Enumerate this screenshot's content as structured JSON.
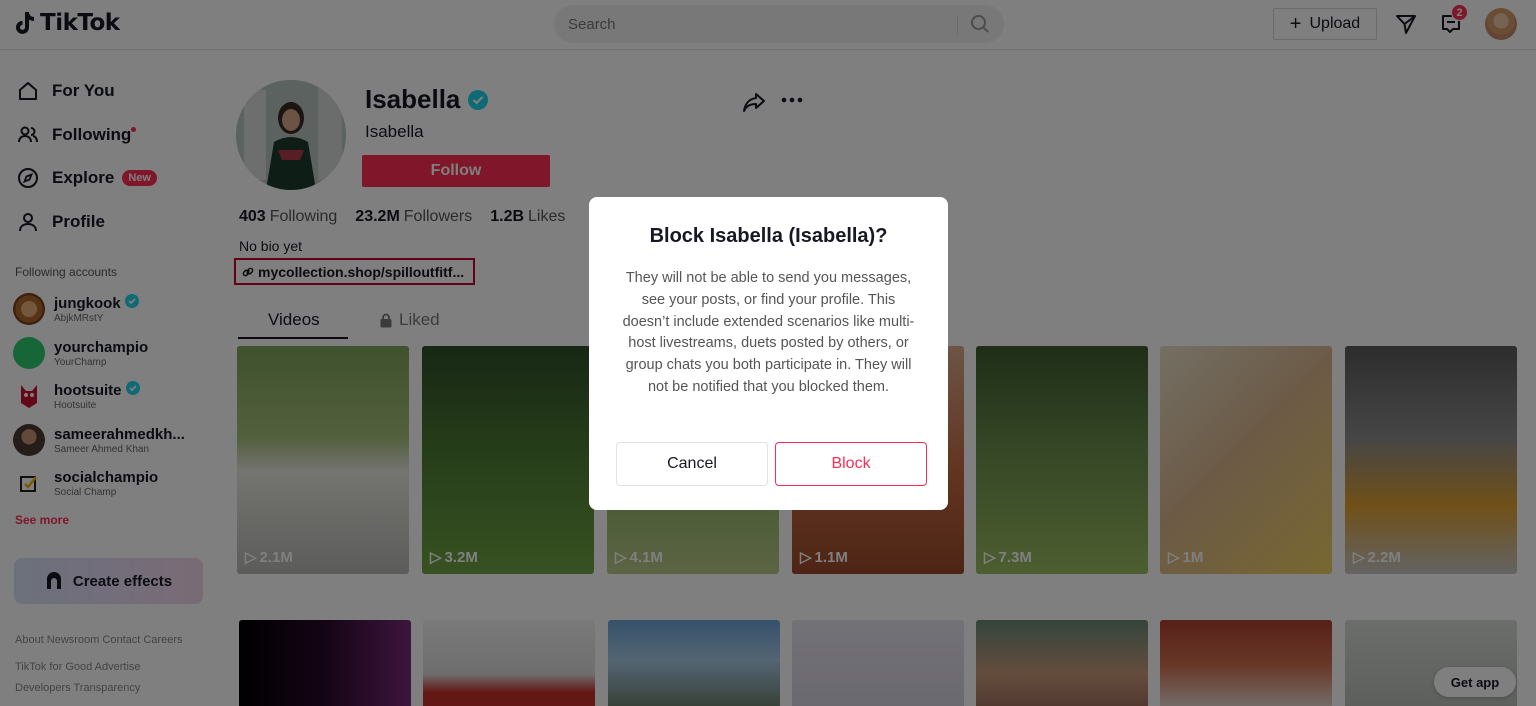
{
  "header": {
    "logo_text": "TikTok",
    "search_placeholder": "Search",
    "upload_label": "Upload",
    "inbox_badge": "2"
  },
  "sidebar": {
    "nav": [
      {
        "label": "For You",
        "icon": "home-icon"
      },
      {
        "label": "Following",
        "icon": "users-icon"
      },
      {
        "label": "Explore",
        "icon": "compass-icon",
        "badge": "New"
      },
      {
        "label": "Profile",
        "icon": "user-icon"
      }
    ],
    "following_title": "Following accounts",
    "accounts": [
      {
        "name": "jungkook",
        "handle": "AbjkMRstY",
        "verified": true
      },
      {
        "name": "yourchampio",
        "handle": "YourChamp",
        "verified": false
      },
      {
        "name": "hootsuite",
        "handle": "Hootsuite",
        "verified": true
      },
      {
        "name": "sameerahmedkh...",
        "handle": "Sameer Ahmed Khan",
        "verified": false
      },
      {
        "name": "socialchampio",
        "handle": "Social Champ",
        "verified": false
      }
    ],
    "see_more": "See more",
    "create_effects": "Create effects",
    "footer_lines": [
      "About  Newsroom  Contact  Careers",
      "TikTok for Good  Advertise",
      "Developers  Transparency"
    ]
  },
  "profile": {
    "name": "Isabella",
    "subtitle": "Isabella",
    "follow_label": "Follow",
    "stats": [
      {
        "value": "403",
        "label": "Following"
      },
      {
        "value": "23.2M",
        "label": "Followers"
      },
      {
        "value": "1.2B",
        "label": "Likes"
      }
    ],
    "bio": "No bio yet",
    "link": "mycollection.shop/spilloutfitf...",
    "tabs": [
      "Videos",
      "Liked"
    ]
  },
  "videos": [
    {
      "views": "2.1M"
    },
    {
      "views": "3.2M"
    },
    {
      "views": "4.1M"
    },
    {
      "views": "1.1M"
    },
    {
      "views": "7.3M"
    },
    {
      "views": "1M"
    },
    {
      "views": "2.2M"
    }
  ],
  "get_app": "Get app",
  "modal": {
    "title": "Block Isabella (Isabella)?",
    "body": "They will not be able to send you messages, see your posts, or find your profile. This doesn’t include extended scenarios like multi-host livestreams, duets posted by others, or group chats you both participate in. They will not be notified that you blocked them.",
    "cancel_label": "Cancel",
    "block_label": "Block"
  },
  "colors": {
    "accent": "#fe2c55",
    "verified": "#20d5ec",
    "link_border": "#c3002f"
  }
}
